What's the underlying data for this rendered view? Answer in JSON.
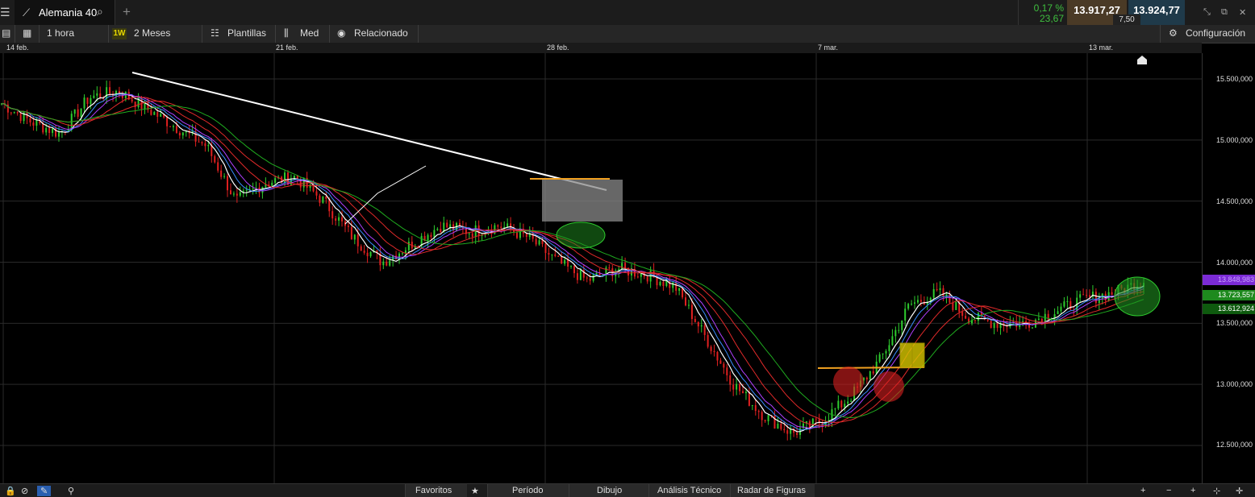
{
  "window": {
    "instrument_name": "Alemania 40",
    "change_percent": "0,17 %",
    "change_abs": "23,67",
    "sell_price": "13.917,27",
    "buy_price": "13.924,77",
    "spread": "7,50"
  },
  "toolbar": {
    "interval": "1 hora",
    "range_badge": "1W",
    "range": "2 Meses",
    "templates": "Plantillas",
    "price_type": "Med",
    "related": "Relacionado",
    "settings": "Configuración"
  },
  "date_axis": [
    "14 feb.",
    "21 feb.",
    "28 feb.",
    "7 mar.",
    "13 mar."
  ],
  "price_axis": [
    "15.500,000",
    "15.000,000",
    "14.500,000",
    "14.000,000",
    "13.500,000",
    "13.000,000",
    "12.500,000"
  ],
  "price_tags": [
    {
      "label": "13.848,983",
      "color": "#7b2bd6"
    },
    {
      "label": "13.723,557",
      "color": "#1e8a1e"
    },
    {
      "label": "13.612,924",
      "color": "#0e6a0e"
    }
  ],
  "bottom_tabs": [
    "Favoritos",
    "Período",
    "Dibujo",
    "Análisis Técnico",
    "Radar de Figuras"
  ],
  "colors": {
    "up": "#2ecc2e",
    "down": "#e02020",
    "ma_white": "#ffffff",
    "ma_blue": "#3a8dff",
    "ma_purple": "#b040ff",
    "ma_red": "#e02a2a",
    "ma_green": "#1faa1f",
    "trendline": "#ffffff",
    "level_line": "#f0a020"
  },
  "chart_data": {
    "type": "line",
    "title": "",
    "ylim": [
      12300,
      15700
    ],
    "x_dates": [
      "14 feb.",
      "21 feb.",
      "28 feb.",
      "7 mar.",
      "13 mar."
    ],
    "series": [
      {
        "values": [
          15300,
          15150,
          15050,
          15350,
          15400,
          15250,
          15100,
          14950,
          14500,
          14650,
          14700,
          14500,
          14200,
          14000,
          14150,
          14300,
          14250,
          14300,
          14200,
          14000,
          13850,
          13950,
          13900,
          13800,
          13400,
          13000,
          12750,
          12600,
          12700,
          12900,
          13200,
          13650,
          13750,
          13550,
          13500,
          13500,
          13600,
          13700,
          13750,
          13850
        ]
      }
    ]
  }
}
